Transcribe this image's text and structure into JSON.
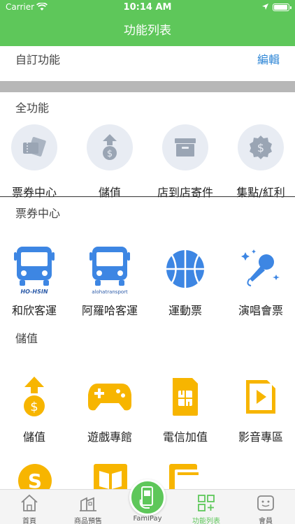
{
  "status": {
    "carrier": "Carrier",
    "time": "10:14 AM"
  },
  "header": {
    "title": "功能列表"
  },
  "custom": {
    "label": "自訂功能",
    "edit": "編輯"
  },
  "all": {
    "label": "全功能",
    "items": [
      {
        "label": "票券中心",
        "icon": "ticket-icon"
      },
      {
        "label": "儲值",
        "icon": "coin-upload-icon"
      },
      {
        "label": "店到店寄件",
        "icon": "package-icon"
      },
      {
        "label": "集點/紅利",
        "icon": "dollar-badge-icon"
      }
    ]
  },
  "tickets": {
    "label": "票券中心",
    "items": [
      {
        "label": "和欣客運",
        "icon": "bus-icon",
        "brand": "HO-HSIN"
      },
      {
        "label": "阿羅哈客運",
        "icon": "bus-icon",
        "brand": "alohatransport"
      },
      {
        "label": "運動票",
        "icon": "basketball-icon"
      },
      {
        "label": "演唱會票",
        "icon": "microphone-icon"
      }
    ]
  },
  "topup": {
    "label": "儲值",
    "items": [
      {
        "label": "儲值",
        "icon": "coin-upload-icon"
      },
      {
        "label": "遊戲專館",
        "icon": "gamepad-icon"
      },
      {
        "label": "電信加值",
        "icon": "sim-card-icon"
      },
      {
        "label": "影音專區",
        "icon": "play-icon"
      }
    ]
  },
  "tabs": [
    {
      "label": "首頁",
      "icon": "home-icon"
    },
    {
      "label": "商品預售",
      "icon": "shop-icon"
    },
    {
      "label": "FamiPay",
      "icon": "phone-pay-icon"
    },
    {
      "label": "功能列表",
      "icon": "grid-plus-icon"
    },
    {
      "label": "會員",
      "icon": "member-icon"
    }
  ],
  "colors": {
    "brand_green": "#5ec75a",
    "blue": "#3d86e3",
    "yellow": "#f7b500",
    "link": "#2e86d6"
  }
}
